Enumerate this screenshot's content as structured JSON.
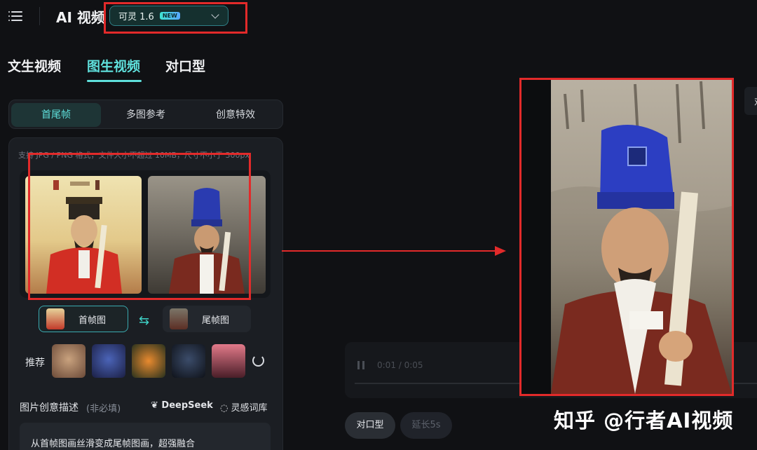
{
  "header": {
    "menu_icon": "menu-icon",
    "app_title": "AI 视频",
    "model_select": {
      "value": "可灵 1.6",
      "badge": "NEW"
    }
  },
  "mode_tabs": [
    {
      "label": "文生视频",
      "active": false
    },
    {
      "label": "图生视频",
      "active": true
    },
    {
      "label": "对口型",
      "active": false
    }
  ],
  "sub_tabs": [
    {
      "label": "首尾帧",
      "active": true
    },
    {
      "label": "多图参考",
      "active": false
    },
    {
      "label": "创意特效",
      "active": false
    }
  ],
  "upload": {
    "hint": "支持 JPG / PNG 格式，文件大小不超过 10MB，尺寸不小于 300px",
    "first_frame_label": "首帧图",
    "last_frame_label": "尾帧图",
    "swap_icon": "swap-icon"
  },
  "recommend": {
    "label": "推荐",
    "refresh_icon": "refresh-icon"
  },
  "description": {
    "label": "图片创意描述",
    "sub_label": "(非必填)",
    "deepseek_label": "DeepSeek",
    "inspiration_label": "灵感词库",
    "prompt_text": "从首帧图画丝滑变成尾帧图画，超强融合"
  },
  "player": {
    "time": "0:01 / 0:05"
  },
  "actions": {
    "lip_sync": "对口型",
    "extend": "延长5s"
  },
  "edge_tab": "对",
  "watermark": "知乎 @行者AI视频",
  "colors": {
    "accent": "#5fe0dc",
    "annotation_red": "#e22a2a",
    "background": "#101114"
  }
}
